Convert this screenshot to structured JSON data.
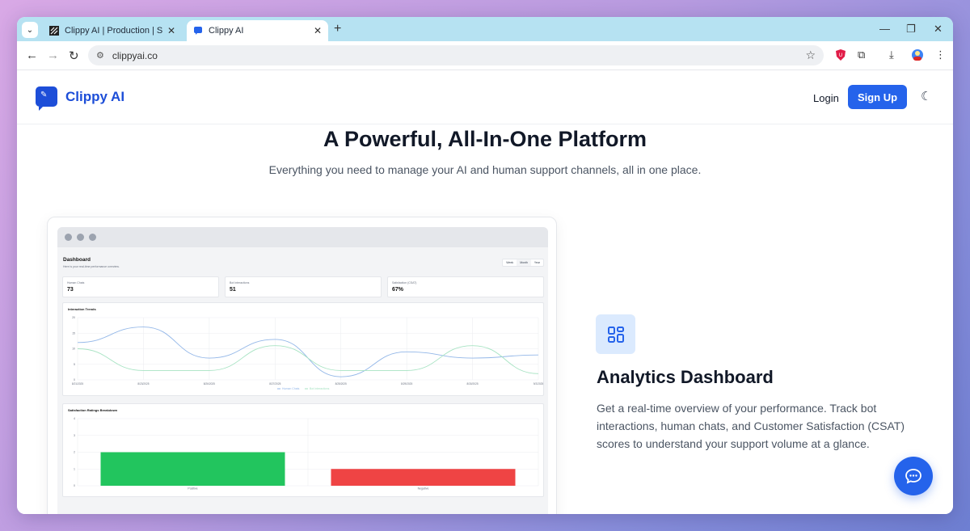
{
  "browser": {
    "tabs": [
      {
        "title": "Clippy AI | Production | Sanity",
        "active": false
      },
      {
        "title": "Clippy AI",
        "active": true
      }
    ],
    "url": "clippyai.co",
    "colors": {
      "tabstrip": "#b6e2f2"
    }
  },
  "site": {
    "brand": "Clippy AI",
    "nav": {
      "login": "Login",
      "signup": "Sign Up"
    },
    "hero": {
      "title": "A Powerful, All-In-One Platform",
      "subtitle": "Everything you need to manage your AI and human support channels, all in one place."
    },
    "feature": {
      "title": "Analytics Dashboard",
      "description": "Get a real-time overview of your performance. Track bot interactions, human chats, and Customer Satisfaction (CSAT) scores to understand your support volume at a glance."
    },
    "colors": {
      "primary": "#2563eb",
      "brand": "#1d4ed8"
    }
  },
  "mockup": {
    "title": "Dashboard",
    "subtitle": "Here is your real-time performance overview.",
    "range_options": [
      "Week",
      "Month",
      "Year"
    ],
    "range_selected": "Month",
    "stats": [
      {
        "label": "Human Chats",
        "value": "73"
      },
      {
        "label": "Bot Interactions",
        "value": "51"
      },
      {
        "label": "Satisfaction (CSAT)",
        "value": "67%"
      }
    ],
    "trend_title": "Interaction Trends",
    "ratings_title": "Satisfaction Ratings Breakdown"
  },
  "chart_data": [
    {
      "type": "line",
      "title": "Interaction Trends",
      "x": [
        "8/21/2025",
        "8/23/2025",
        "8/26/2025",
        "8/27/2025",
        "8/28/2025",
        "8/29/2025",
        "8/30/2025",
        "9/2/2025"
      ],
      "ylim": [
        0,
        20
      ],
      "yticks": [
        0,
        5,
        10,
        15,
        20
      ],
      "series": [
        {
          "name": "Human Chats",
          "color": "#93b7e8",
          "values": [
            12,
            17,
            7,
            13,
            1,
            9,
            7,
            8
          ]
        },
        {
          "name": "Bot Interactions",
          "color": "#a7e3c3",
          "values": [
            10,
            3,
            3,
            11,
            3,
            3,
            11,
            2
          ]
        }
      ],
      "legend": "bottom"
    },
    {
      "type": "bar",
      "title": "Satisfaction Ratings Breakdown",
      "categories": [
        "Positive",
        "Negative"
      ],
      "values": [
        2,
        1
      ],
      "colors": [
        "#22c55e",
        "#ef4444"
      ],
      "ylim": [
        0,
        4
      ],
      "yticks": [
        0,
        1,
        2,
        3,
        4
      ]
    }
  ]
}
